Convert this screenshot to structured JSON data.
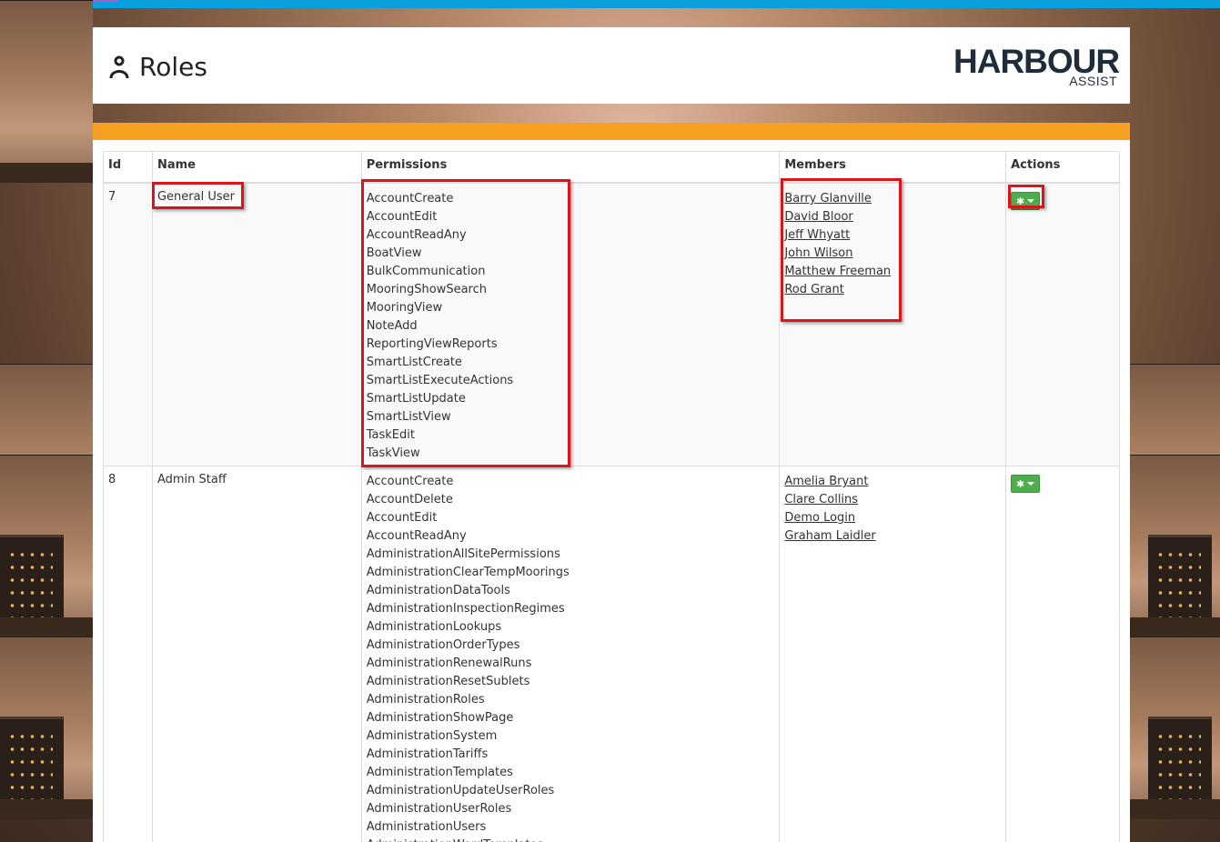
{
  "page": {
    "title": "Roles",
    "logo_main": "HARBOUR",
    "logo_sub": "ASSIST"
  },
  "table": {
    "headers": [
      "Id",
      "Name",
      "Permissions",
      "Members",
      "Actions"
    ],
    "rows": [
      {
        "id": "7",
        "name": "General User",
        "permissions": [
          "AccountCreate",
          "AccountEdit",
          "AccountReadAny",
          "BoatView",
          "BulkCommunication",
          "MooringShowSearch",
          "MooringView",
          "NoteAdd",
          "ReportingViewReports",
          "SmartListCreate",
          "SmartListExecuteActions",
          "SmartListUpdate",
          "SmartListView",
          "TaskEdit",
          "TaskView"
        ],
        "members": [
          "Barry Glanville",
          "David Bloor",
          "Jeff Whyatt",
          "John Wilson",
          "Matthew Freeman",
          "Rod Grant"
        ]
      },
      {
        "id": "8",
        "name": "Admin Staff",
        "permissions": [
          "AccountCreate",
          "AccountDelete",
          "AccountEdit",
          "AccountReadAny",
          "AdministrationAllSitePermissions",
          "AdministrationClearTempMoorings",
          "AdministrationDataTools",
          "AdministrationInspectionRegimes",
          "AdministrationLookups",
          "AdministrationOrderTypes",
          "AdministrationRenewalRuns",
          "AdministrationResetSublets",
          "AdministrationRoles",
          "AdministrationShowPage",
          "AdministrationSystem",
          "AdministrationTariffs",
          "AdministrationTemplates",
          "AdministrationUpdateUserRoles",
          "AdministrationUserRoles",
          "AdministrationUsers",
          "AdministrationWordTemplates"
        ],
        "members": [
          "Amelia Bryant",
          "Clare Collins",
          "Demo Login",
          "Graham Laidler"
        ]
      }
    ]
  },
  "colors": {
    "topbar": "#0aa0dd",
    "panel_bar": "#f5a020",
    "action_button": "#4cae4c",
    "highlight": "#d9151b"
  },
  "icons": {
    "title": "person-icon",
    "action": "gear-icon"
  }
}
